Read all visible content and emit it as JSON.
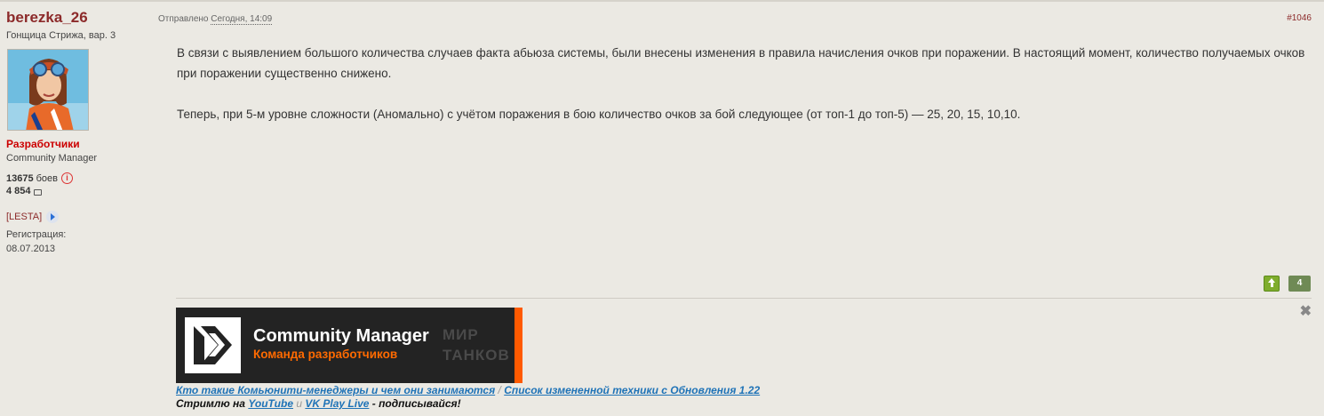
{
  "author": {
    "username": "berezka_26",
    "title": "Гонщица Стрижа, вар. 3",
    "group": "Разработчики",
    "role": "Community Manager",
    "battles_count": "13675",
    "battles_label": "боев",
    "messages_count": "4 854",
    "clan": "[LESTA]",
    "registered_label": "Регистрация:",
    "registered_date": "08.07.2013"
  },
  "post": {
    "posted_label": "Отправлено",
    "posted_date": "Сегодня, 14:09",
    "number": "#1046",
    "paragraph1": "В связи с выявлением большого количества случаев факта абьюза системы, были внесены изменения в правила начисления очков при поражении. В настоящий момент, количество получаемых очков при поражении существенно снижено.",
    "paragraph2": "Теперь, при 5-м уровне сложности (Аномально) с учётом поражения в бою количество очков за бой следующее (от топ-1 до топ-5) — 25, 20, 15, 10,10.",
    "rating": "4"
  },
  "signature": {
    "close_symbol": "✖",
    "banner_title": "Community Manager",
    "banner_subtitle": "Команда разработчиков",
    "banner_watermark_line1": "МИР",
    "banner_watermark_line2": "ТАНКОВ",
    "link1": "Кто такие Комьюнити-менеджеры и чем они занимаются",
    "separator": "/",
    "link2": "Список измененной техники с Обновления 1.22",
    "stream_prefix": "Стримлю на",
    "youtube": "YouTube",
    "conj": "u",
    "vkplay": "VK Play Live",
    "stream_suffix": "- подписывайся!"
  },
  "colors": {
    "username": "#8c2a2a",
    "group": "#cc0000",
    "link": "#1f73b7",
    "banner_accent": "#ff5a00",
    "background": "#ebe9e3"
  },
  "icons": {
    "info": "info-icon",
    "messages": "message-icon",
    "clan_link": "arrow-right-icon",
    "rate_up": "arrow-up-icon",
    "close": "close-icon"
  }
}
